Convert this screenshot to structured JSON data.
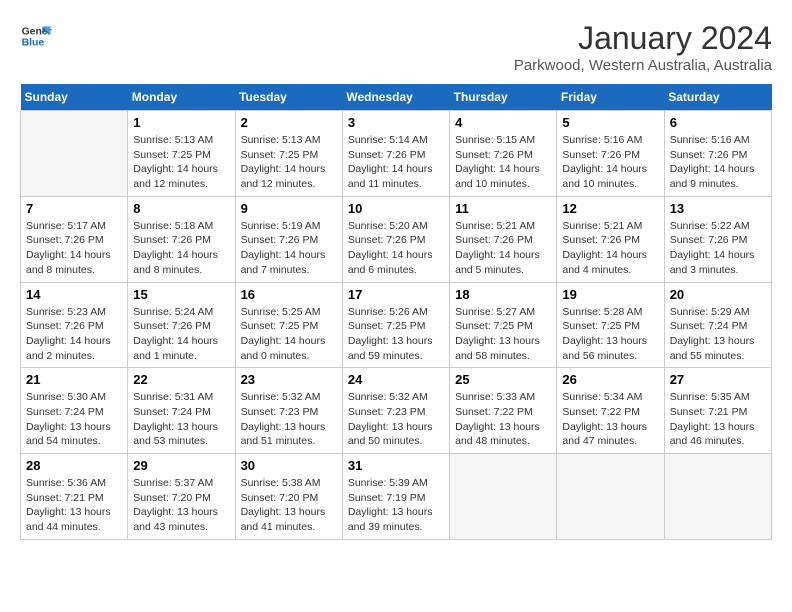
{
  "logo": {
    "line1": "General",
    "line2": "Blue"
  },
  "title": "January 2024",
  "location": "Parkwood, Western Australia, Australia",
  "days_of_week": [
    "Sunday",
    "Monday",
    "Tuesday",
    "Wednesday",
    "Thursday",
    "Friday",
    "Saturday"
  ],
  "weeks": [
    [
      {
        "day": "",
        "info": ""
      },
      {
        "day": "1",
        "info": "Sunrise: 5:13 AM\nSunset: 7:25 PM\nDaylight: 14 hours\nand 12 minutes."
      },
      {
        "day": "2",
        "info": "Sunrise: 5:13 AM\nSunset: 7:25 PM\nDaylight: 14 hours\nand 12 minutes."
      },
      {
        "day": "3",
        "info": "Sunrise: 5:14 AM\nSunset: 7:26 PM\nDaylight: 14 hours\nand 11 minutes."
      },
      {
        "day": "4",
        "info": "Sunrise: 5:15 AM\nSunset: 7:26 PM\nDaylight: 14 hours\nand 10 minutes."
      },
      {
        "day": "5",
        "info": "Sunrise: 5:16 AM\nSunset: 7:26 PM\nDaylight: 14 hours\nand 10 minutes."
      },
      {
        "day": "6",
        "info": "Sunrise: 5:16 AM\nSunset: 7:26 PM\nDaylight: 14 hours\nand 9 minutes."
      }
    ],
    [
      {
        "day": "7",
        "info": "Sunrise: 5:17 AM\nSunset: 7:26 PM\nDaylight: 14 hours\nand 8 minutes."
      },
      {
        "day": "8",
        "info": "Sunrise: 5:18 AM\nSunset: 7:26 PM\nDaylight: 14 hours\nand 8 minutes."
      },
      {
        "day": "9",
        "info": "Sunrise: 5:19 AM\nSunset: 7:26 PM\nDaylight: 14 hours\nand 7 minutes."
      },
      {
        "day": "10",
        "info": "Sunrise: 5:20 AM\nSunset: 7:26 PM\nDaylight: 14 hours\nand 6 minutes."
      },
      {
        "day": "11",
        "info": "Sunrise: 5:21 AM\nSunset: 7:26 PM\nDaylight: 14 hours\nand 5 minutes."
      },
      {
        "day": "12",
        "info": "Sunrise: 5:21 AM\nSunset: 7:26 PM\nDaylight: 14 hours\nand 4 minutes."
      },
      {
        "day": "13",
        "info": "Sunrise: 5:22 AM\nSunset: 7:26 PM\nDaylight: 14 hours\nand 3 minutes."
      }
    ],
    [
      {
        "day": "14",
        "info": "Sunrise: 5:23 AM\nSunset: 7:26 PM\nDaylight: 14 hours\nand 2 minutes."
      },
      {
        "day": "15",
        "info": "Sunrise: 5:24 AM\nSunset: 7:26 PM\nDaylight: 14 hours\nand 1 minute."
      },
      {
        "day": "16",
        "info": "Sunrise: 5:25 AM\nSunset: 7:25 PM\nDaylight: 14 hours\nand 0 minutes."
      },
      {
        "day": "17",
        "info": "Sunrise: 5:26 AM\nSunset: 7:25 PM\nDaylight: 13 hours\nand 59 minutes."
      },
      {
        "day": "18",
        "info": "Sunrise: 5:27 AM\nSunset: 7:25 PM\nDaylight: 13 hours\nand 58 minutes."
      },
      {
        "day": "19",
        "info": "Sunrise: 5:28 AM\nSunset: 7:25 PM\nDaylight: 13 hours\nand 56 minutes."
      },
      {
        "day": "20",
        "info": "Sunrise: 5:29 AM\nSunset: 7:24 PM\nDaylight: 13 hours\nand 55 minutes."
      }
    ],
    [
      {
        "day": "21",
        "info": "Sunrise: 5:30 AM\nSunset: 7:24 PM\nDaylight: 13 hours\nand 54 minutes."
      },
      {
        "day": "22",
        "info": "Sunrise: 5:31 AM\nSunset: 7:24 PM\nDaylight: 13 hours\nand 53 minutes."
      },
      {
        "day": "23",
        "info": "Sunrise: 5:32 AM\nSunset: 7:23 PM\nDaylight: 13 hours\nand 51 minutes."
      },
      {
        "day": "24",
        "info": "Sunrise: 5:32 AM\nSunset: 7:23 PM\nDaylight: 13 hours\nand 50 minutes."
      },
      {
        "day": "25",
        "info": "Sunrise: 5:33 AM\nSunset: 7:22 PM\nDaylight: 13 hours\nand 48 minutes."
      },
      {
        "day": "26",
        "info": "Sunrise: 5:34 AM\nSunset: 7:22 PM\nDaylight: 13 hours\nand 47 minutes."
      },
      {
        "day": "27",
        "info": "Sunrise: 5:35 AM\nSunset: 7:21 PM\nDaylight: 13 hours\nand 46 minutes."
      }
    ],
    [
      {
        "day": "28",
        "info": "Sunrise: 5:36 AM\nSunset: 7:21 PM\nDaylight: 13 hours\nand 44 minutes."
      },
      {
        "day": "29",
        "info": "Sunrise: 5:37 AM\nSunset: 7:20 PM\nDaylight: 13 hours\nand 43 minutes."
      },
      {
        "day": "30",
        "info": "Sunrise: 5:38 AM\nSunset: 7:20 PM\nDaylight: 13 hours\nand 41 minutes."
      },
      {
        "day": "31",
        "info": "Sunrise: 5:39 AM\nSunset: 7:19 PM\nDaylight: 13 hours\nand 39 minutes."
      },
      {
        "day": "",
        "info": ""
      },
      {
        "day": "",
        "info": ""
      },
      {
        "day": "",
        "info": ""
      }
    ]
  ]
}
